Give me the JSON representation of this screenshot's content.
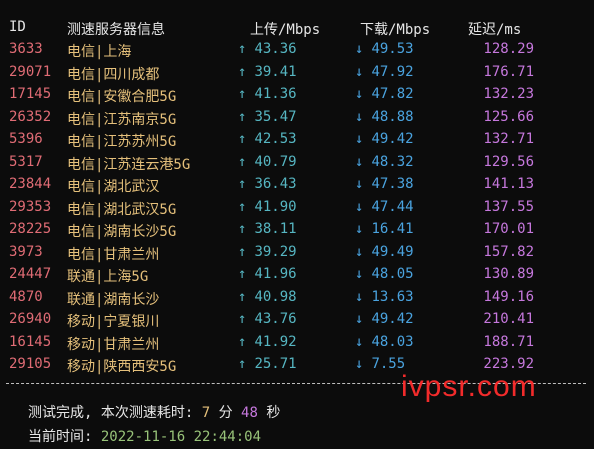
{
  "header": {
    "id": "ID",
    "server": "测速服务器信息",
    "upload": "上传/Mbps",
    "download": "下载/Mbps",
    "latency": "延迟/ms"
  },
  "arrows": {
    "up": "↑",
    "down": "↓"
  },
  "rows": [
    {
      "id": "3633",
      "isp": "电信|上海",
      "up": "43.36",
      "down": "49.53",
      "lat": "128.29"
    },
    {
      "id": "29071",
      "isp": "电信|四川成都",
      "up": "39.41",
      "down": "47.92",
      "lat": "176.71"
    },
    {
      "id": "17145",
      "isp": "电信|安徽合肥5G",
      "up": "41.36",
      "down": "47.82",
      "lat": "132.23"
    },
    {
      "id": "26352",
      "isp": "电信|江苏南京5G",
      "up": "35.47",
      "down": "48.88",
      "lat": "125.66"
    },
    {
      "id": "5396",
      "isp": "电信|江苏苏州5G",
      "up": "42.53",
      "down": "49.42",
      "lat": "132.71"
    },
    {
      "id": "5317",
      "isp": "电信|江苏连云港5G",
      "up": "40.79",
      "down": "48.32",
      "lat": "129.56"
    },
    {
      "id": "23844",
      "isp": "电信|湖北武汉",
      "up": "36.43",
      "down": "47.38",
      "lat": "141.13"
    },
    {
      "id": "29353",
      "isp": "电信|湖北武汉5G",
      "up": "41.90",
      "down": "47.44",
      "lat": "137.55"
    },
    {
      "id": "28225",
      "isp": "电信|湖南长沙5G",
      "up": "38.11",
      "down": "16.41",
      "lat": "170.01"
    },
    {
      "id": "3973",
      "isp": "电信|甘肃兰州",
      "up": "39.29",
      "down": "49.49",
      "lat": "157.82"
    },
    {
      "id": "24447",
      "isp": "联通|上海5G",
      "up": "41.96",
      "down": "48.05",
      "lat": "130.89"
    },
    {
      "id": "4870",
      "isp": "联通|湖南长沙",
      "up": "40.98",
      "down": "13.63",
      "lat": "149.16"
    },
    {
      "id": "26940",
      "isp": "移动|宁夏银川",
      "up": "43.76",
      "down": "49.42",
      "lat": "210.41"
    },
    {
      "id": "16145",
      "isp": "移动|甘肃兰州",
      "up": "41.92",
      "down": "48.03",
      "lat": "188.71"
    },
    {
      "id": "29105",
      "isp": "移动|陕西西安5G",
      "up": "25.71",
      "down": "7.55",
      "lat": "223.92"
    }
  ],
  "watermark": "ivpsr.com",
  "footer": {
    "done_label": "测试完成, 本次测速耗时:",
    "minutes": "7",
    "min_unit": "分",
    "seconds": "48",
    "sec_unit": "秒",
    "time_label": "当前时间:",
    "time_value": "2022-11-16 22:44:04"
  }
}
